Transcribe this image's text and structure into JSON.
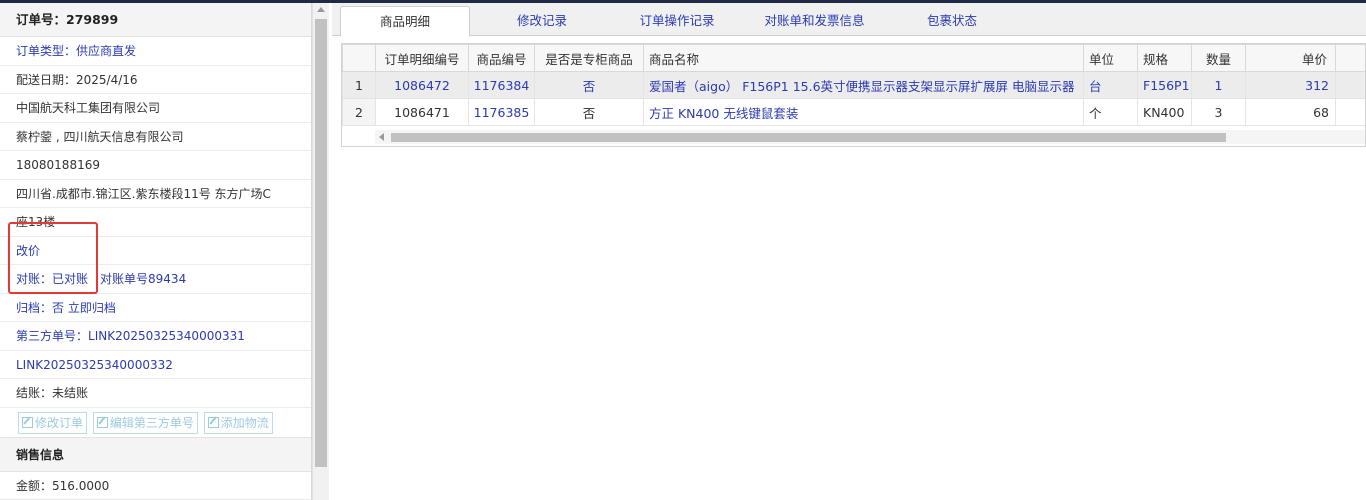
{
  "order": {
    "title": "订单号：279899",
    "type_label": "订单类型：",
    "type_value": "供应商直发",
    "delivery_date": "配送日期：2025/4/16",
    "company": "中国航天科工集团有限公司",
    "contact": "蔡柠蓥 , 四川航天信息有限公司",
    "phone": "18080188169",
    "address_line1": "四川省.成都市.锦江区.紫东楼段11号 东方广场C",
    "address_line2": "座13楼",
    "reprice": "改价",
    "reconcile_label": "对账：",
    "reconcile_status": "已对账",
    "reconcile_no": "对账单号89434",
    "archive_label": "归档：",
    "archive_value": "否",
    "archive_action": "立即归档",
    "third_party_label": "第三方单号：",
    "third_party_no1": "LINK20250325340000331",
    "third_party_no2": "LINK20250325340000332",
    "settle": "结账：未结账"
  },
  "buttons": {
    "edit_order": "修改订单",
    "edit_third_party": "编辑第三方单号",
    "add_logistics": "添加物流"
  },
  "sales": {
    "header": "销售信息",
    "amount": "金额：516.0000"
  },
  "tabs": [
    {
      "label": "商品明细"
    },
    {
      "label": "修改记录"
    },
    {
      "label": "订单操作记录"
    },
    {
      "label": "对账单和发票信息"
    },
    {
      "label": "包裹状态"
    }
  ],
  "grid": {
    "headers": {
      "detail_id": "订单明细编号",
      "product_id": "商品编号",
      "is_cabinet": "是否是专柜商品",
      "name": "商品名称",
      "unit": "单位",
      "spec": "规格",
      "qty": "数量",
      "price": "单价"
    },
    "rows": [
      {
        "rn": "1",
        "detail_id": "1086472",
        "product_id": "1176384",
        "is_cabinet": "否",
        "name": "爱国者（aigo） F156P1 15.6英寸便携显示器支架显示屏扩展屏 电脑显示器",
        "unit": "台",
        "spec": "F156P1",
        "qty": "1",
        "price": "312"
      },
      {
        "rn": "2",
        "detail_id": "1086471",
        "product_id": "1176385",
        "is_cabinet": "否",
        "name": "方正 KN400 无线键鼠套装",
        "unit": "个",
        "spec": "KN400",
        "qty": "3",
        "price": "68"
      }
    ]
  }
}
